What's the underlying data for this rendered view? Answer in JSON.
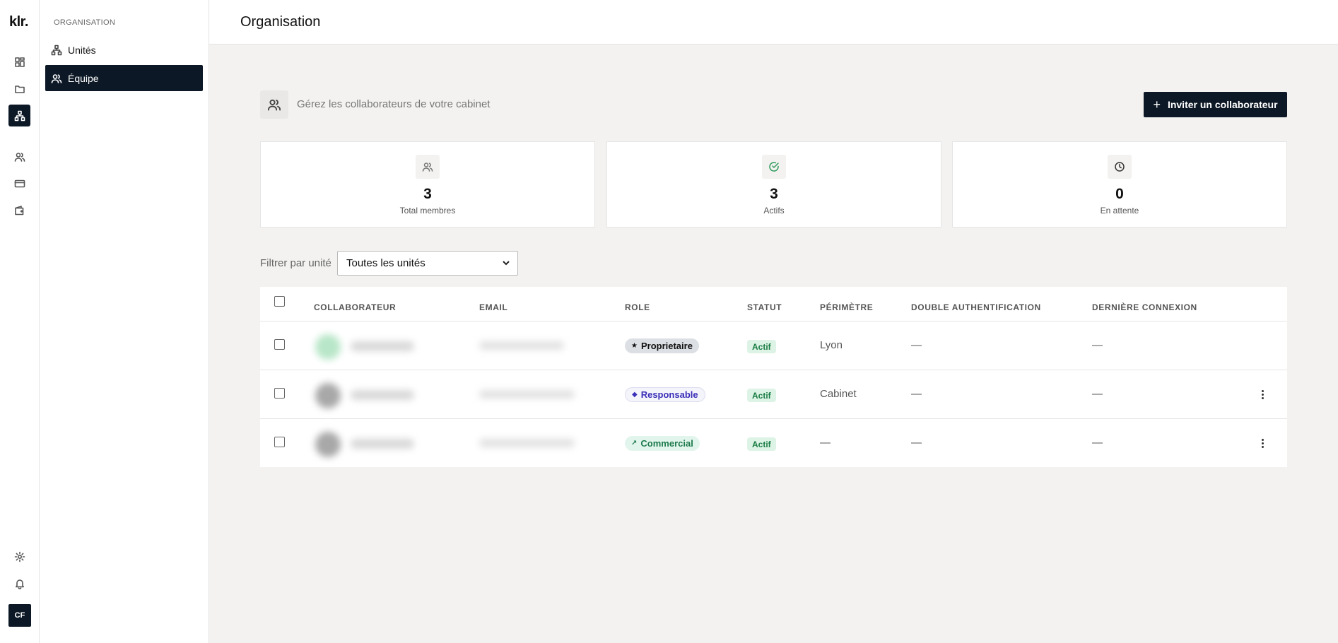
{
  "app": {
    "logo": "klr."
  },
  "rail": {
    "items": [
      {
        "icon": "dashboard-icon"
      },
      {
        "icon": "folder-icon"
      },
      {
        "icon": "org-tree-icon",
        "active": true
      },
      {
        "icon": "users-icon"
      },
      {
        "icon": "card-icon"
      },
      {
        "icon": "wallet-icon"
      }
    ],
    "bottom": [
      {
        "icon": "gear-icon"
      },
      {
        "icon": "bell-icon"
      }
    ],
    "avatar_initials": "CF"
  },
  "subnav": {
    "title": "ORGANISATION",
    "items": [
      {
        "label": "Unités",
        "icon": "org-tree-icon",
        "active": false
      },
      {
        "label": "Équipe",
        "icon": "users-icon",
        "active": true
      }
    ]
  },
  "header": {
    "title": "Organisation"
  },
  "intro": {
    "text": "Gérez les collaborateurs de votre cabinet",
    "invite_label": "Inviter un collaborateur"
  },
  "stats": [
    {
      "value": "3",
      "label": "Total membres",
      "icon": "users-icon",
      "color": "#666666"
    },
    {
      "value": "3",
      "label": "Actifs",
      "icon": "check-circle-icon",
      "color": "#2e9a5a"
    },
    {
      "value": "0",
      "label": "En attente",
      "icon": "clock-icon",
      "color": "#333333"
    }
  ],
  "filter": {
    "label": "Filtrer par unité",
    "selected": "Toutes les unités"
  },
  "table": {
    "headers": {
      "collaborator": "COLLABORATEUR",
      "email": "EMAIL",
      "role": "ROLE",
      "status": "STATUT",
      "scope": "PÉRIMÈTRE",
      "twofa": "DOUBLE AUTHENTIFICATION",
      "last_login": "DERNIÈRE CONNEXION"
    },
    "rows": [
      {
        "role": "Proprietaire",
        "role_glyph": "★",
        "status": "Actif",
        "scope": "Lyon",
        "twofa": "—",
        "last_login": "—",
        "avatar_color": "#b8e6c8"
      },
      {
        "role": "Responsable",
        "role_glyph": "◆",
        "status": "Actif",
        "scope": "Cabinet",
        "twofa": "—",
        "last_login": "—",
        "avatar_color": "#a8a8a8"
      },
      {
        "role": "Commercial",
        "role_glyph": "↗",
        "status": "Actif",
        "scope": "—",
        "twofa": "—",
        "last_login": "—",
        "avatar_color": "#a8a8a8"
      }
    ]
  }
}
